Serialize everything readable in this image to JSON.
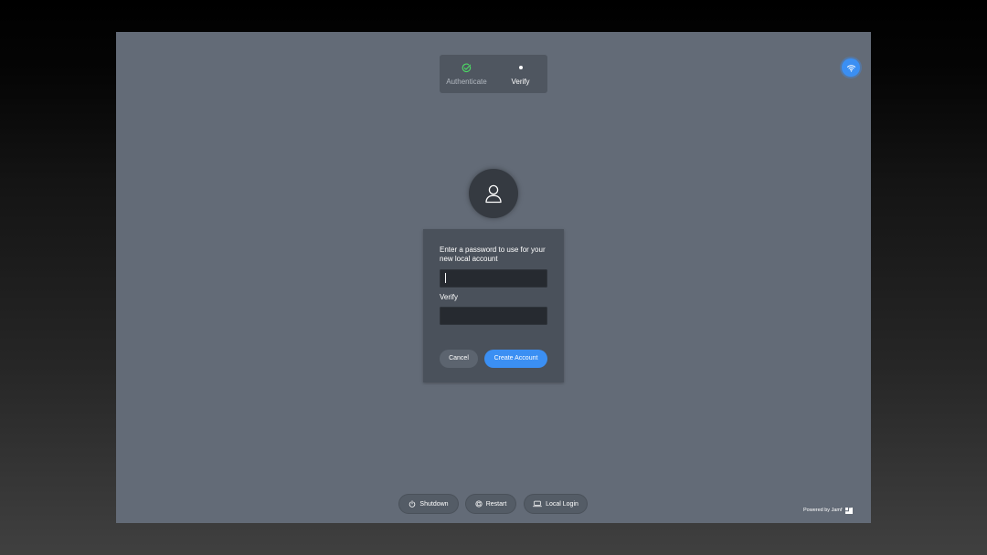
{
  "stepper": {
    "steps": [
      {
        "label": "Authenticate",
        "state": "complete",
        "icon": "check-circle-icon"
      },
      {
        "label": "Verify",
        "state": "current",
        "icon": "dot-icon"
      }
    ]
  },
  "wifi": {
    "icon": "wifi-icon"
  },
  "avatar": {
    "icon": "user-icon"
  },
  "form": {
    "prompt": "Enter a password to use for your new local account",
    "password_value": "",
    "verify_label": "Verify",
    "verify_value": "",
    "cancel_label": "Cancel",
    "create_label": "Create Account"
  },
  "footer": {
    "shutdown_label": "Shutdown",
    "restart_label": "Restart",
    "local_login_label": "Local Login",
    "powered_by": "Powered by Jamf"
  },
  "colors": {
    "accent": "#3b8ff3",
    "screen_background": "#636b77",
    "panel_background": "#4a515b",
    "check_green": "#4cd964"
  }
}
